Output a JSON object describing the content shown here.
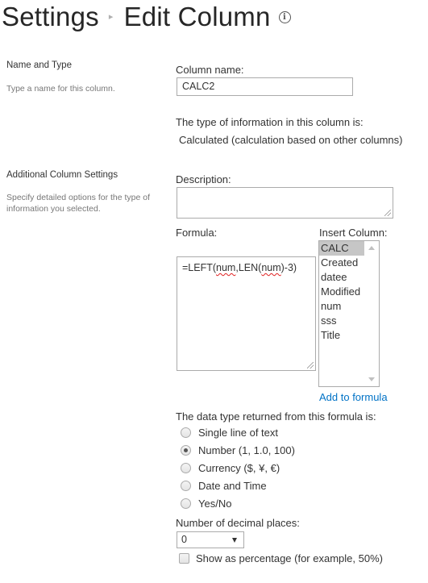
{
  "header": {
    "breadcrumb_root": "Settings",
    "breadcrumb_separator": "▸",
    "page_title": "Edit Column",
    "info_icon": "info-icon"
  },
  "sections": {
    "name_and_type": {
      "heading": "Name and Type",
      "description": "Type a name for this column."
    },
    "additional": {
      "heading": "Additional Column Settings",
      "description": "Specify detailed options for the type of information you selected."
    }
  },
  "column_name": {
    "label": "Column name:",
    "value": "CALC2"
  },
  "type_info": {
    "label": "The type of information in this column is:",
    "value": "Calculated (calculation based on other columns)"
  },
  "description": {
    "label": "Description:",
    "value": ""
  },
  "formula": {
    "label": "Formula:",
    "prefix": "=LEFT(",
    "token1": "num",
    "middle": ",LEN(",
    "token2": "num",
    "suffix": ")-3)"
  },
  "insert_column": {
    "label": "Insert Column:",
    "items": [
      "CALC",
      "Created",
      "datee",
      "Modified",
      "num",
      "sss",
      "Title"
    ],
    "selected": "CALC",
    "add_link": "Add to formula"
  },
  "data_type": {
    "label": "The data type returned from this formula is:",
    "options": [
      {
        "label": "Single line of text",
        "checked": false
      },
      {
        "label": "Number (1, 1.0, 100)",
        "checked": true
      },
      {
        "label": "Currency ($, ¥, €)",
        "checked": false
      },
      {
        "label": "Date and Time",
        "checked": false
      },
      {
        "label": "Yes/No",
        "checked": false
      }
    ]
  },
  "decimal_places": {
    "label": "Number of decimal places:",
    "value": "0"
  },
  "show_percentage": {
    "label": "Show as percentage (for example, 50%)",
    "checked": false
  },
  "colors": {
    "link": "#0072c6",
    "selected_list_item": "#c6c6c6",
    "border": "#ababab"
  }
}
